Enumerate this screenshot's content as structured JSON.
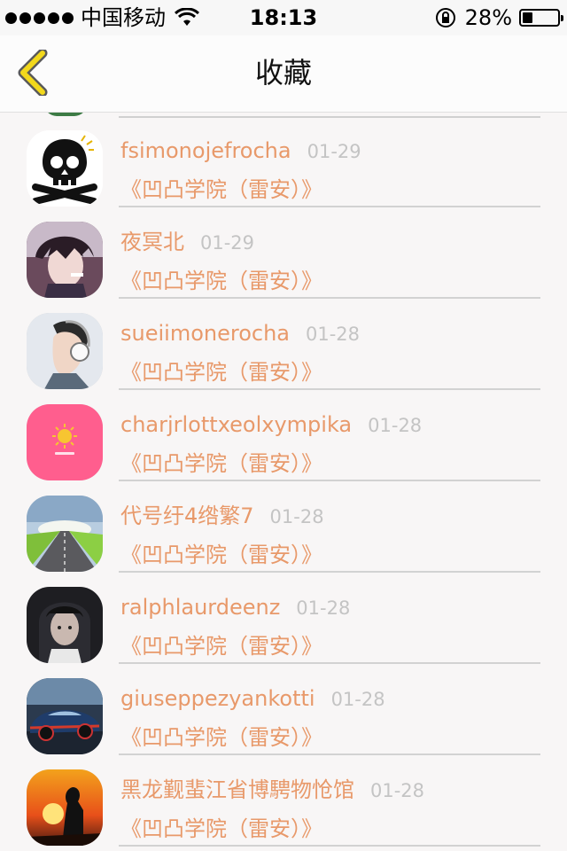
{
  "status_bar": {
    "carrier": "中国移动",
    "time": "18:13",
    "battery": "28%",
    "battery_level": 0.28
  },
  "nav": {
    "title": "收藏",
    "back_icon": "chevron-left-icon",
    "accent": "#f2d81c"
  },
  "colors": {
    "name": "#e8996a",
    "date": "#c4c4c4"
  },
  "items": [
    {
      "name": "fsimonojefrocha",
      "date": "01-29",
      "title": "《凹凸学院（雷安）》",
      "avatar": "skull-avatar"
    },
    {
      "name": "夜冥北",
      "date": "01-29",
      "title": "《凹凸学院（雷安）》",
      "avatar": "anime-boy-avatar"
    },
    {
      "name": "sueiimonerocha",
      "date": "01-28",
      "title": "《凹凸学院（雷安）》",
      "avatar": "headphones-boy-avatar"
    },
    {
      "name": "charjrlottxeolxympika",
      "date": "01-28",
      "title": "《凹凸学院（雷安）》",
      "avatar": "sun-avatar"
    },
    {
      "name": "代号纡4绺繁7",
      "date": "01-28",
      "title": "《凹凸学院（雷安）》",
      "avatar": "road-avatar"
    },
    {
      "name": "ralphlaurdeenz",
      "date": "01-28",
      "title": "《凹凸学院（雷安）》",
      "avatar": "hooded-person-avatar"
    },
    {
      "name": "giuseppezyankotti",
      "date": "01-28",
      "title": "《凹凸学院（雷安）》",
      "avatar": "sports-car-avatar"
    },
    {
      "name": "黑龙觐蜚江省博騁物怆馆",
      "date": "01-28",
      "title": "《凹凸学院（雷安）》",
      "avatar": "sunset-silhouette-avatar"
    }
  ]
}
